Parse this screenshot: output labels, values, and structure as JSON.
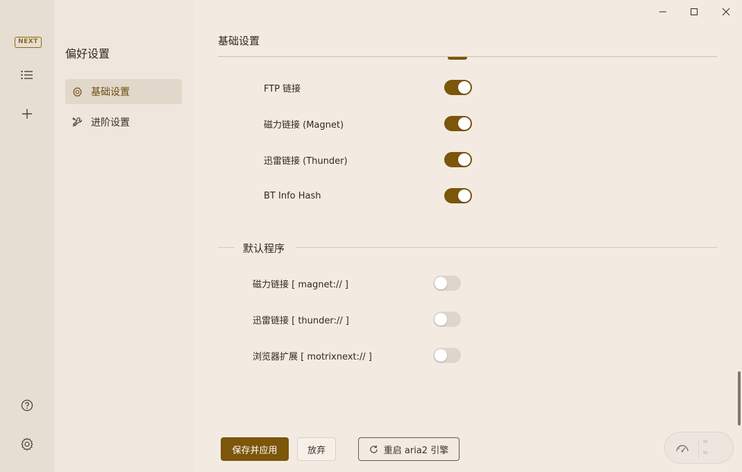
{
  "rail": {
    "logo_text": "NEXT",
    "icons": [
      "list-icon",
      "plus-icon",
      "help-icon",
      "settings-icon"
    ]
  },
  "nav": {
    "title": "偏好设置",
    "items": [
      {
        "label": "基础设置",
        "icon": "gear-icon",
        "active": true
      },
      {
        "label": "进阶设置",
        "icon": "tools-icon",
        "active": false
      }
    ]
  },
  "main": {
    "section_title": "基础设置",
    "protocol_toggles": [
      {
        "label": "FTP 链接",
        "enabled": true
      },
      {
        "label": "磁力链接 (Magnet)",
        "enabled": true
      },
      {
        "label": "迅雷链接 (Thunder)",
        "enabled": true
      },
      {
        "label": "BT Info Hash",
        "enabled": true
      }
    ],
    "default_app_title": "默认程序",
    "default_app_toggles": [
      {
        "label": "磁力链接 [ magnet:// ]",
        "enabled": false
      },
      {
        "label": "迅雷链接 [ thunder:// ]",
        "enabled": false
      },
      {
        "label": "浏览器扩展 [ motrixnext:// ]",
        "enabled": false
      }
    ]
  },
  "footer": {
    "save_label": "保存并应用",
    "discard_label": "放弃",
    "restart_label": "重启 aria2 引擎"
  },
  "speed_widget": {
    "upload": "∞",
    "download": "∞"
  },
  "colors": {
    "accent": "#7c560a",
    "background": "#f3ebe2",
    "rail": "#e6ddd3",
    "nav": "#efe7de"
  }
}
